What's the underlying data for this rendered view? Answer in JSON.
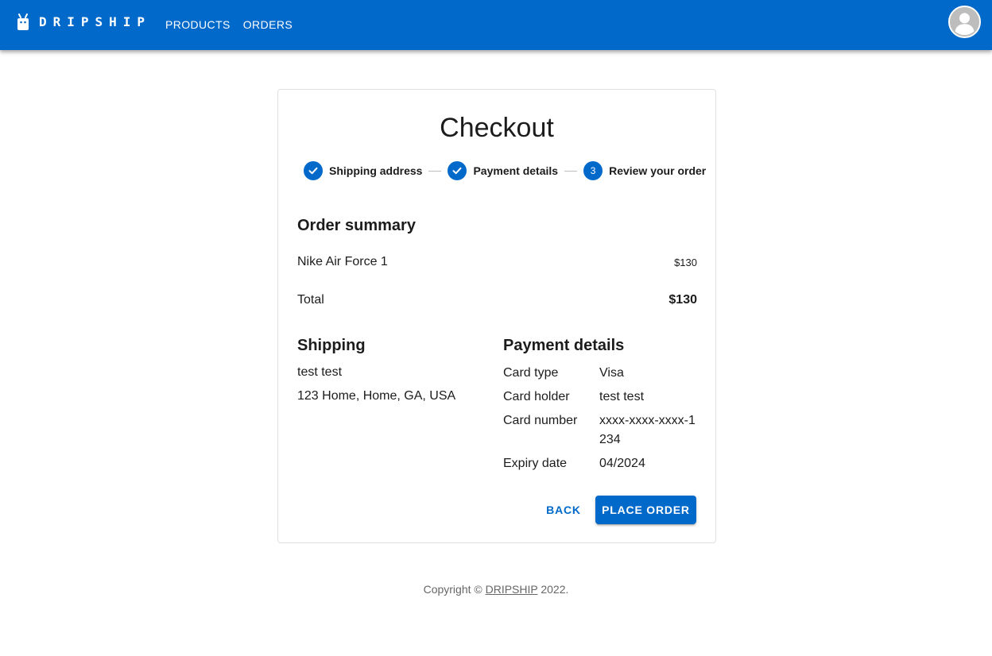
{
  "header": {
    "brand": "DRIPSHIP",
    "nav": [
      {
        "label": "PRODUCTS"
      },
      {
        "label": "ORDERS"
      }
    ],
    "brand_color": "#0069c9"
  },
  "checkout": {
    "title": "Checkout",
    "steps": [
      {
        "label": "Shipping address",
        "state": "completed"
      },
      {
        "label": "Payment details",
        "state": "completed"
      },
      {
        "label": "Review your order",
        "state": "active",
        "number": "3"
      }
    ],
    "order_summary": {
      "title": "Order summary",
      "items": [
        {
          "name": "Nike Air Force 1",
          "price": "$130"
        }
      ],
      "total_label": "Total",
      "total_value": "$130"
    },
    "shipping": {
      "title": "Shipping",
      "name": "test test",
      "address": "123 Home, Home, GA, USA"
    },
    "payment": {
      "title": "Payment details",
      "rows": [
        {
          "label": "Card type",
          "value": "Visa"
        },
        {
          "label": "Card holder",
          "value": "test test"
        },
        {
          "label": "Card number",
          "value": "xxxx-xxxx-xxxx-1234"
        },
        {
          "label": "Expiry date",
          "value": "04/2024"
        }
      ]
    },
    "buttons": {
      "back": "BACK",
      "place_order": "PLACE ORDER"
    }
  },
  "footer": {
    "prefix": "Copyright © ",
    "link": "DRIPSHIP",
    "suffix": " 2022."
  }
}
